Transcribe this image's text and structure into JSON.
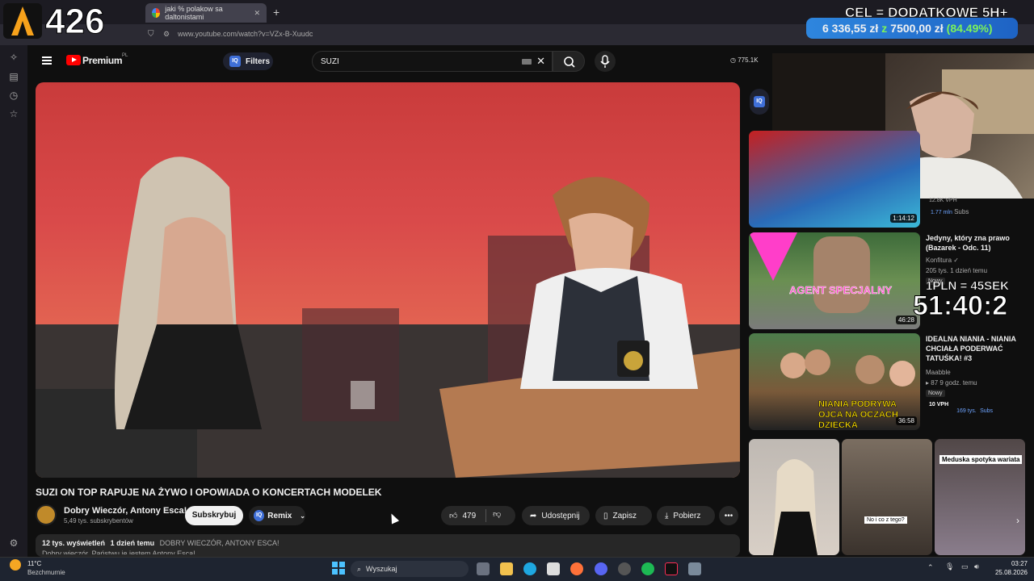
{
  "overlay": {
    "counter": "426",
    "goal_title": "CEL = DODATKOWE 5H+",
    "goal_current": "6 336,55 zł",
    "goal_sep": "z",
    "goal_target": "7500,00 zł",
    "goal_percent": "(84.49%)",
    "rate": "1PLN = 45SEK",
    "timer": "51:40:2"
  },
  "browser": {
    "tab_title": "jaki % polakow sa daltonistami",
    "url": "www.youtube.com/watch?v=VZx-B-Xuudc"
  },
  "youtube": {
    "brand": "Premium",
    "region": "PL",
    "filters_label": "Filters",
    "search_value": "SUZI",
    "views_indicator": "775.1K"
  },
  "video": {
    "title": "SUZI ON TOP RAPUJE NA ŻYWO I OPOWIADA O KONCERTACH MODELEK",
    "channel": "Dobry Wieczór, Antony Esca!",
    "subscribers": "5,49 tys. subskrybentów",
    "subscribe_label": "Subskrybuj",
    "remix_label": "Remix",
    "likes": "479",
    "share_label": "Udostępnij",
    "save_label": "Zapisz",
    "download_label": "Pobierz",
    "desc_views": "12 tys. wyświetleń",
    "desc_date": "1 dzień temu",
    "desc_tags": "DOBRY WIECZÓR, ANTONY ESCA!",
    "desc_text": "Dobry wieczór. Państwu je jestem Antony Esca!"
  },
  "recommendations": [
    {
      "duration": "1:14:12",
      "meta_vph": "12.8K VPH",
      "subs": "1.77 mln",
      "subs_label": "Subs"
    },
    {
      "title": "Jedyny, który zna prawo (Bazarek - Odc. 11)",
      "channel": "Konfitura",
      "meta": "205 tys.  1 dzień temu",
      "badge": "Nowy",
      "duration": "46:28",
      "thumb_text": "AGENT SPECJALNY"
    },
    {
      "title": "IDEALNA NIANIA - NIANIA CHCIAŁA PODERWAĆ TATUŚKA! #3",
      "channel": "Maabble",
      "meta": "87  9 godz. temu",
      "badge": "Nowy",
      "vph": "10 VPH",
      "subs": "169 tys.",
      "subs_label": "Subs",
      "duration": "36:58",
      "thumb_text": "NIANIA PODRYWA OJCA NA OCZACH DZIECKA"
    }
  ],
  "shorts": [
    {
      "caption": ""
    },
    {
      "caption": "No i co z tego?"
    },
    {
      "caption": "Meduska spotyka wariata"
    }
  ],
  "taskbar": {
    "weather_temp": "11°C",
    "weather_desc": "Bezchmurnie",
    "search_label": "Wyszukaj",
    "time": "03:27",
    "date": "25.08.2026"
  }
}
